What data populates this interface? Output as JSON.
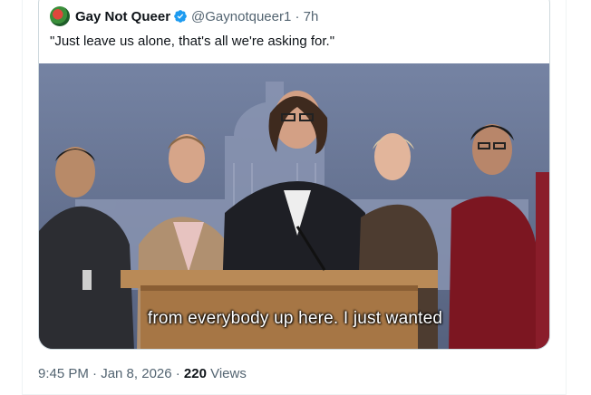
{
  "quote": {
    "display_name": "Gay Not Queer",
    "verified": true,
    "handle_time": "@Gaynotqueer1 · 7h",
    "text": "\"Just leave us alone, that's all we're asking for.\"",
    "video_caption": "from everybody up here. I just wanted"
  },
  "tweet_meta": {
    "time_date": "9:45 PM · Jan 8, 2026 · ",
    "views_count": "220",
    "views_label": " Views"
  },
  "colors": {
    "verified_blue": "#1d9bf0",
    "text_primary": "#0f1419",
    "text_secondary": "#536471",
    "border": "#cfd9de"
  },
  "icons": {
    "verified": "verified-badge-icon",
    "avatar": "avatar-image"
  }
}
